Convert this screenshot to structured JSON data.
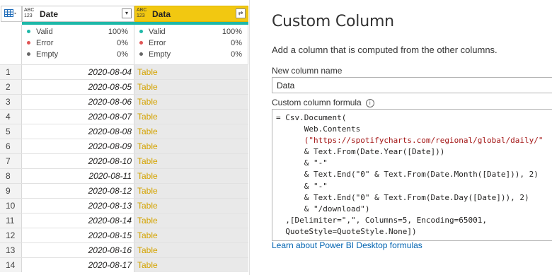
{
  "grid": {
    "date_column": {
      "type_icon": "ABC\n123",
      "name": "Date"
    },
    "data_column": {
      "type_icon": "ABC\n123",
      "name": "Data"
    },
    "quality": {
      "date": [
        {
          "label": "Valid",
          "value": "100%",
          "color": "#1fb8a8"
        },
        {
          "label": "Error",
          "value": "0%",
          "color": "#e05555"
        },
        {
          "label": "Empty",
          "value": "0%",
          "color": "#666666"
        }
      ],
      "data": [
        {
          "label": "Valid",
          "value": "100%",
          "color": "#1fb8a8"
        },
        {
          "label": "Error",
          "value": "0%",
          "color": "#e05555"
        },
        {
          "label": "Empty",
          "value": "0%",
          "color": "#666666"
        }
      ]
    },
    "rows": [
      {
        "n": "1",
        "date": "2020-08-04",
        "data": "Table"
      },
      {
        "n": "2",
        "date": "2020-08-05",
        "data": "Table"
      },
      {
        "n": "3",
        "date": "2020-08-06",
        "data": "Table"
      },
      {
        "n": "4",
        "date": "2020-08-07",
        "data": "Table"
      },
      {
        "n": "5",
        "date": "2020-08-08",
        "data": "Table"
      },
      {
        "n": "6",
        "date": "2020-08-09",
        "data": "Table"
      },
      {
        "n": "7",
        "date": "2020-08-10",
        "data": "Table"
      },
      {
        "n": "8",
        "date": "2020-08-11",
        "data": "Table"
      },
      {
        "n": "9",
        "date": "2020-08-12",
        "data": "Table"
      },
      {
        "n": "10",
        "date": "2020-08-13",
        "data": "Table"
      },
      {
        "n": "11",
        "date": "2020-08-14",
        "data": "Table"
      },
      {
        "n": "12",
        "date": "2020-08-15",
        "data": "Table"
      },
      {
        "n": "13",
        "date": "2020-08-16",
        "data": "Table"
      },
      {
        "n": "14",
        "date": "2020-08-17",
        "data": "Table"
      }
    ]
  },
  "dialog": {
    "title": "Custom Column",
    "description": "Add a column that is computed from the other columns.",
    "name_label": "New column name",
    "name_value": "Data",
    "formula_label": "Custom column formula",
    "formula_lines": [
      "= Csv.Document(",
      "      Web.Contents",
      "      (\"https://spotifycharts.com/regional/global/daily/\"",
      "      & Text.From(Date.Year([Date]))",
      "      & \"-\"",
      "      & Text.End(\"0\" & Text.From(Date.Month([Date])), 2)",
      "      & \"-\"",
      "      & Text.End(\"0\" & Text.From(Date.Day([Date])), 2)",
      "      & \"/download\")",
      "  ,[Delimiter=\",\", Columns=5, Encoding=65001,",
      "  QuoteStyle=QuoteStyle.None])"
    ],
    "help_link": "Learn about Power BI Desktop formulas"
  }
}
